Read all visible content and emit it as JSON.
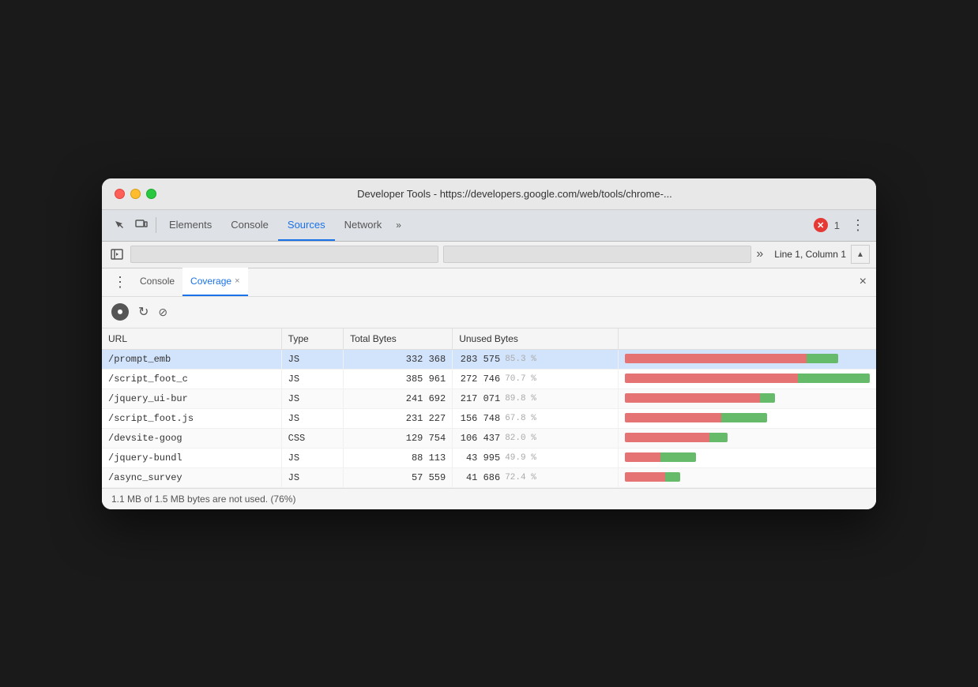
{
  "window": {
    "title": "Developer Tools - https://developers.google.com/web/tools/chrome-...",
    "traffic_lights": [
      "red",
      "yellow",
      "green"
    ]
  },
  "devtools": {
    "tabs": [
      {
        "label": "Elements",
        "active": false
      },
      {
        "label": "Console",
        "active": false
      },
      {
        "label": "Sources",
        "active": true
      },
      {
        "label": "Network",
        "active": false
      }
    ],
    "more_label": "»",
    "error_count": "1",
    "menu_label": "⋮"
  },
  "sources": {
    "line_col": "Line 1, Column 1",
    "breadcrumb_placeholder": "",
    "breadcrumb_value": ""
  },
  "secondary_toolbar": {
    "dots_label": "⋮",
    "tabs": [
      {
        "label": "Console",
        "active": false,
        "closeable": false
      },
      {
        "label": "Coverage",
        "active": true,
        "closeable": true
      }
    ],
    "close_label": "×"
  },
  "coverage": {
    "controls": {
      "record_title": "Start instrumenting coverage and reload page",
      "refresh_title": "Reload",
      "stop_title": "Stop"
    },
    "table": {
      "headers": [
        "URL",
        "Type",
        "Total Bytes",
        "Unused Bytes",
        ""
      ],
      "rows": [
        {
          "url": "/prompt_emb",
          "type": "JS",
          "total_bytes": "332 368",
          "unused_bytes": "283 575",
          "unused_pct": "85.3 %",
          "bar_unused_pct": 85.3,
          "bar_total_width": 270,
          "selected": true
        },
        {
          "url": "/script_foot_c",
          "type": "JS",
          "total_bytes": "385 961",
          "unused_bytes": "272 746",
          "unused_pct": "70.7 %",
          "bar_unused_pct": 70.7,
          "bar_total_width": 310,
          "selected": false
        },
        {
          "url": "/jquery_ui-bur",
          "type": "JS",
          "total_bytes": "241 692",
          "unused_bytes": "217 071",
          "unused_pct": "89.8 %",
          "bar_unused_pct": 89.8,
          "bar_total_width": 190,
          "selected": false
        },
        {
          "url": "/script_foot.js",
          "type": "JS",
          "total_bytes": "231 227",
          "unused_bytes": "156 748",
          "unused_pct": "67.8 %",
          "bar_unused_pct": 67.8,
          "bar_total_width": 180,
          "selected": false
        },
        {
          "url": "/devsite-goog",
          "type": "CSS",
          "total_bytes": "129 754",
          "unused_bytes": "106 437",
          "unused_pct": "82.0 %",
          "bar_unused_pct": 82.0,
          "bar_total_width": 130,
          "selected": false
        },
        {
          "url": "/jquery-bundl",
          "type": "JS",
          "total_bytes": "88 113",
          "unused_bytes": "43 995",
          "unused_pct": "49.9 %",
          "bar_unused_pct": 49.9,
          "bar_total_width": 90,
          "selected": false
        },
        {
          "url": "/async_survey",
          "type": "JS",
          "total_bytes": "57 559",
          "unused_bytes": "41 686",
          "unused_pct": "72.4 %",
          "bar_unused_pct": 72.4,
          "bar_total_width": 70,
          "selected": false
        }
      ]
    },
    "status": "1.1 MB of 1.5 MB bytes are not used. (76%)"
  }
}
